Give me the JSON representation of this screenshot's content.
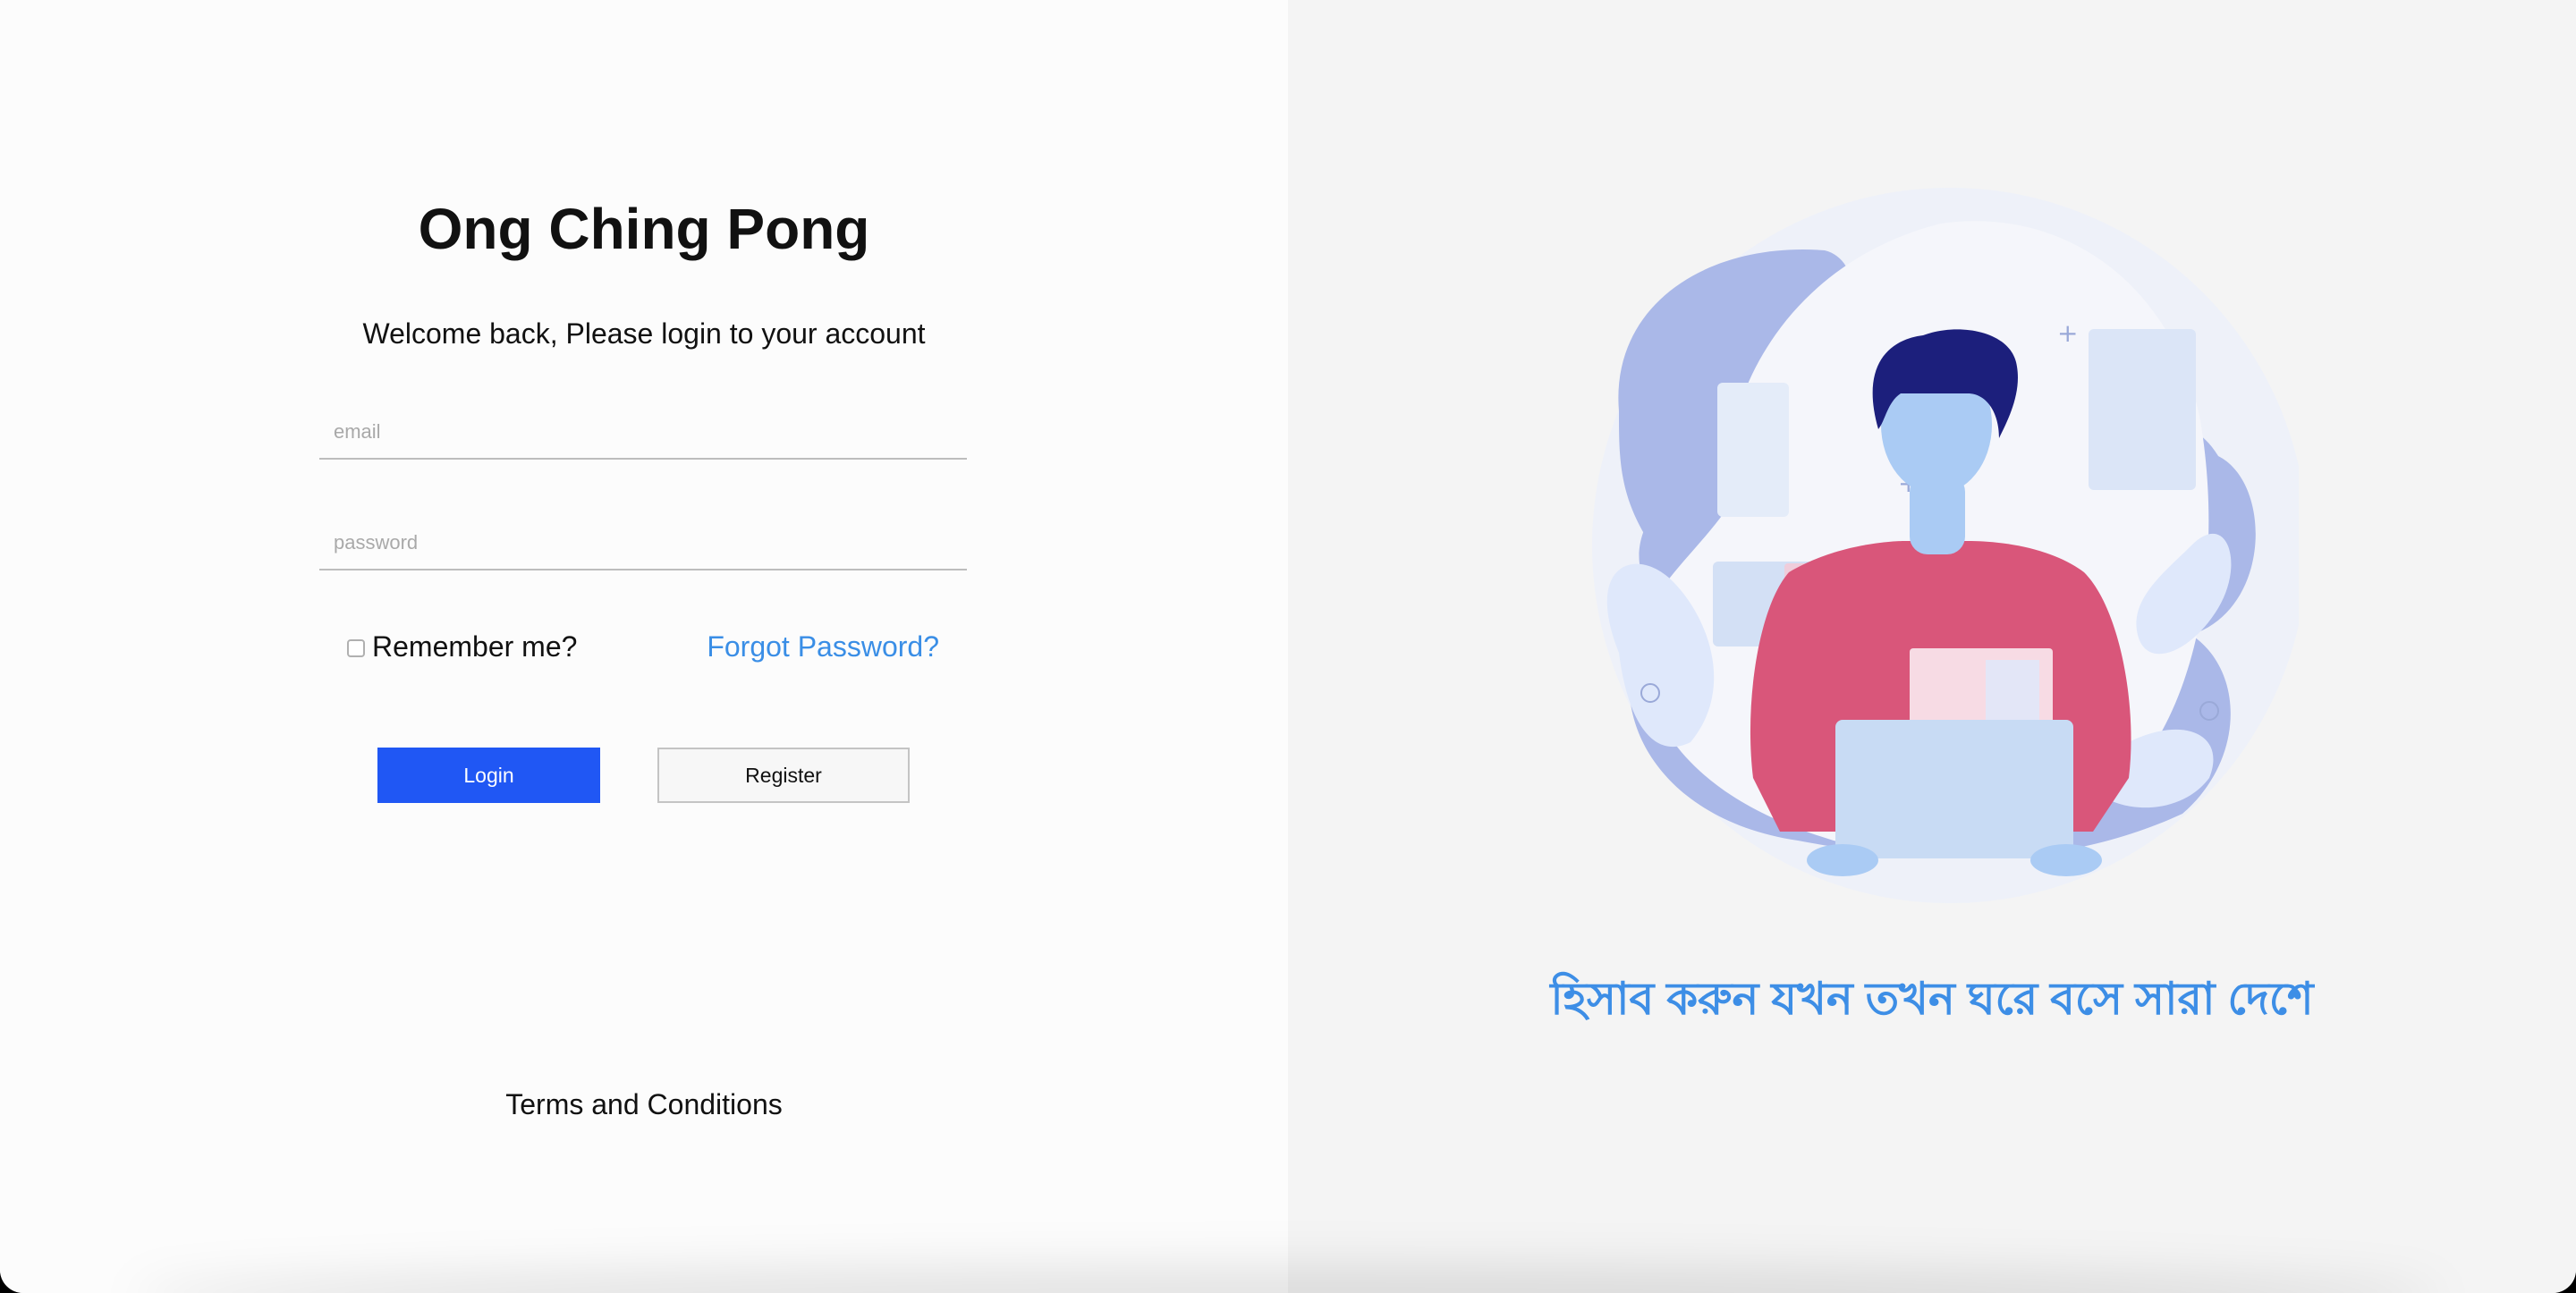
{
  "login": {
    "title": "Ong Ching Pong",
    "subtitle": "Welcome back, Please login to your account",
    "email_placeholder": "email",
    "password_placeholder": "password",
    "remember_label": "Remember me?",
    "remember_checked": false,
    "forgot_label": "Forgot Password?",
    "login_button": "Login",
    "register_button": "Register",
    "terms_label": "Terms and Conditions"
  },
  "promo": {
    "tagline": "হিসাব করুন যখন তখন ঘরে বসে সারা দেশে"
  },
  "colors": {
    "primary": "#2057f4",
    "link": "#3a8ee6",
    "tagline": "#3d8ee6",
    "shirt": "#d9567a",
    "hair": "#1c1f7c",
    "skin": "#aacbf4",
    "blob": "#aab8e8"
  }
}
